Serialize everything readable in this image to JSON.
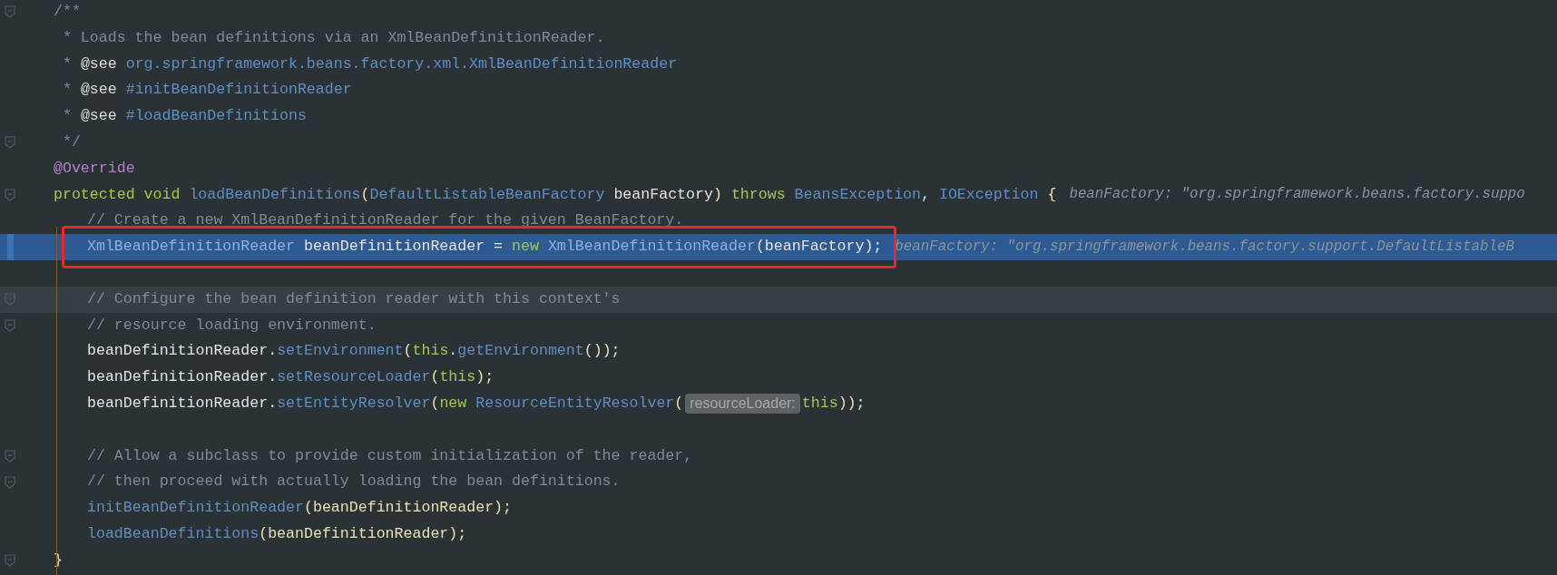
{
  "editor": {
    "lines": [
      {
        "kind": "member",
        "selected": false,
        "current": false,
        "fold": true,
        "tokens": [
          {
            "kind": "doc",
            "text": "/**"
          }
        ]
      },
      {
        "kind": "member",
        "selected": false,
        "current": false,
        "fold": false,
        "tokens": [
          {
            "kind": "doc",
            "text": " * Loads the bean definitions via an XmlBeanDefinitionReader."
          }
        ]
      },
      {
        "kind": "member",
        "selected": false,
        "current": false,
        "fold": false,
        "tokens": [
          {
            "kind": "doc",
            "text": " * "
          },
          {
            "kind": "doc_tag",
            "text": "@see"
          },
          {
            "kind": "doc_link",
            "text": " org.springframework.beans.factory.xml.XmlBeanDefinitionReader"
          }
        ]
      },
      {
        "kind": "member",
        "selected": false,
        "current": false,
        "fold": false,
        "tokens": [
          {
            "kind": "doc",
            "text": " * "
          },
          {
            "kind": "doc_tag",
            "text": "@see"
          },
          {
            "kind": "doc_link",
            "text": " #initBeanDefinitionReader"
          }
        ]
      },
      {
        "kind": "member",
        "selected": false,
        "current": false,
        "fold": false,
        "tokens": [
          {
            "kind": "doc",
            "text": " * "
          },
          {
            "kind": "doc_tag",
            "text": "@see"
          },
          {
            "kind": "doc_link",
            "text": " #loadBeanDefinitions"
          }
        ]
      },
      {
        "kind": "member",
        "selected": false,
        "current": false,
        "fold": true,
        "tokens": [
          {
            "kind": "doc",
            "text": " */"
          }
        ]
      },
      {
        "kind": "member",
        "selected": false,
        "current": false,
        "fold": false,
        "tokens": [
          {
            "kind": "annotation",
            "text": "@Override"
          }
        ]
      },
      {
        "kind": "member",
        "selected": false,
        "current": false,
        "fold": true,
        "tokens": [
          {
            "kind": "keyword",
            "text": "protected void "
          },
          {
            "kind": "method",
            "text": "loadBeanDefinitions"
          },
          {
            "kind": "punct",
            "text": "("
          },
          {
            "kind": "type",
            "text": "DefaultListableBeanFactory"
          },
          {
            "kind": "ident",
            "text": " beanFactory"
          },
          {
            "kind": "punct",
            "text": ") "
          },
          {
            "kind": "keyword",
            "text": "throws "
          },
          {
            "kind": "type",
            "text": "BeansException"
          },
          {
            "kind": "ident",
            "text": ", "
          },
          {
            "kind": "type",
            "text": "IOException"
          },
          {
            "kind": "punct",
            "text": " {"
          },
          {
            "kind": "hint",
            "text": "beanFactory: \"org.springframework.beans.factory.suppo"
          }
        ]
      },
      {
        "kind": "body",
        "selected": false,
        "current": false,
        "fold": false,
        "tokens": [
          {
            "kind": "comment",
            "text": "// Create a new XmlBeanDefinitionReader for the given BeanFactory."
          }
        ]
      },
      {
        "kind": "body",
        "selected": true,
        "current": false,
        "fold": false,
        "tokens": [
          {
            "kind": "type",
            "text": "XmlBeanDefinitionReader"
          },
          {
            "kind": "ident",
            "text": " beanDefinitionReader = "
          },
          {
            "kind": "keyword",
            "text": "new "
          },
          {
            "kind": "type",
            "text": "XmlBeanDefinitionReader"
          },
          {
            "kind": "ident",
            "text": "(beanFactory);"
          },
          {
            "kind": "hint",
            "text": "beanFactory: \"org.springframework.beans.factory.support.DefaultListableB"
          }
        ]
      },
      {
        "kind": "body",
        "selected": false,
        "current": false,
        "fold": false
      },
      {
        "kind": "body",
        "selected": false,
        "current": true,
        "fold": true,
        "tokens": [
          {
            "kind": "comment",
            "text": "// Configure the bean definition reader with this context's"
          }
        ]
      },
      {
        "kind": "body",
        "selected": false,
        "current": false,
        "fold": true,
        "tokens": [
          {
            "kind": "comment",
            "text": "// resource loading environment."
          }
        ]
      },
      {
        "kind": "body",
        "selected": false,
        "current": false,
        "fold": false,
        "tokens": [
          {
            "kind": "ident",
            "text": "beanDefinitionReader."
          },
          {
            "kind": "method",
            "text": "setEnvironment"
          },
          {
            "kind": "punct",
            "text": "("
          },
          {
            "kind": "keyword",
            "text": "this"
          },
          {
            "kind": "ident",
            "text": "."
          },
          {
            "kind": "method",
            "text": "getEnvironment"
          },
          {
            "kind": "punct",
            "text": "());"
          }
        ]
      },
      {
        "kind": "body",
        "selected": false,
        "current": false,
        "fold": false,
        "tokens": [
          {
            "kind": "ident",
            "text": "beanDefinitionReader."
          },
          {
            "kind": "method",
            "text": "setResourceLoader"
          },
          {
            "kind": "punct",
            "text": "("
          },
          {
            "kind": "keyword",
            "text": "this"
          },
          {
            "kind": "punct",
            "text": ");"
          }
        ]
      },
      {
        "kind": "body",
        "selected": false,
        "current": false,
        "fold": false,
        "tokens": [
          {
            "kind": "ident",
            "text": "beanDefinitionReader."
          },
          {
            "kind": "method",
            "text": "setEntityResolver"
          },
          {
            "kind": "punct",
            "text": "("
          },
          {
            "kind": "keyword",
            "text": "new "
          },
          {
            "kind": "type",
            "text": "ResourceEntityResolver"
          },
          {
            "kind": "punct",
            "text": "("
          },
          {
            "kind": "param_hint",
            "text": "resourceLoader:"
          },
          {
            "kind": "keyword",
            "text": "this"
          },
          {
            "kind": "punct",
            "text": "));"
          }
        ]
      },
      {
        "kind": "body",
        "selected": false,
        "current": false,
        "fold": false
      },
      {
        "kind": "body",
        "selected": false,
        "current": false,
        "fold": true,
        "tokens": [
          {
            "kind": "comment",
            "text": "// Allow a subclass to provide custom initialization of the reader,"
          }
        ]
      },
      {
        "kind": "body",
        "selected": false,
        "current": false,
        "fold": true,
        "tokens": [
          {
            "kind": "comment",
            "text": "// then proceed with actually loading the bean definitions."
          }
        ]
      },
      {
        "kind": "body",
        "selected": false,
        "current": false,
        "fold": false,
        "tokens": [
          {
            "kind": "method",
            "text": "initBeanDefinitionReader"
          },
          {
            "kind": "punct",
            "text": "(beanDefinitionReader);"
          }
        ]
      },
      {
        "kind": "body",
        "selected": false,
        "current": false,
        "fold": false,
        "tokens": [
          {
            "kind": "method",
            "text": "loadBeanDefinitions"
          },
          {
            "kind": "punct",
            "text": "(beanDefinitionReader);"
          }
        ]
      },
      {
        "kind": "member",
        "selected": false,
        "current": false,
        "fold": true,
        "tokens": [
          {
            "kind": "punct",
            "text": "}"
          }
        ]
      }
    ]
  }
}
